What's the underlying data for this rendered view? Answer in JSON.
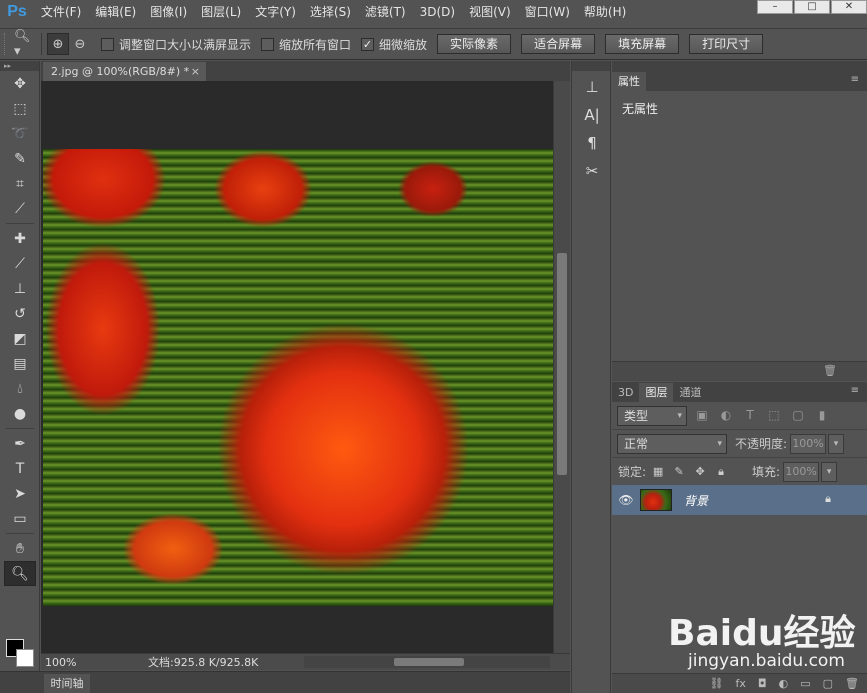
{
  "menubar": {
    "logo": "Ps",
    "items": [
      "文件(F)",
      "编辑(E)",
      "图像(I)",
      "图层(L)",
      "文字(Y)",
      "选择(S)",
      "滤镜(T)",
      "3D(D)",
      "视图(V)",
      "窗口(W)",
      "帮助(H)"
    ],
    "window_controls": [
      "–",
      "□",
      "✕"
    ]
  },
  "options": {
    "resize_windows": "调整窗口大小以满屏显示",
    "zoom_all": "缩放所有窗口",
    "scrubby_zoom": "细微缩放",
    "scrubby_checked": true,
    "btn_actual": "实际像素",
    "btn_fit": "适合屏幕",
    "btn_fill": "填充屏幕",
    "btn_print": "打印尺寸"
  },
  "document": {
    "tab_title": "2.jpg @ 100%(RGB/8#) *",
    "tab_close": "×",
    "zoom": "100%",
    "doc_size": "文档:925.8 K/925.8K"
  },
  "timeline": {
    "label": "时间轴"
  },
  "panels": {
    "properties_tab": "属性",
    "properties_text": "无属性",
    "tab_3d": "3D",
    "tab_layers": "图层",
    "tab_channels": "通道",
    "filter_kind": "类型",
    "blend_mode": "正常",
    "opacity_label": "不透明度:",
    "opacity_value": "100%",
    "lock_label": "锁定:",
    "fill_label": "填充:",
    "fill_value": "100%",
    "layer_name": "背景"
  },
  "watermark": {
    "brand": "Baidu经验",
    "url": "jingyan.baidu.com"
  },
  "colors": {
    "foreground": "#000000",
    "background": "#ffffff",
    "selected_layer": "#5a6f8a",
    "ps_logo": "#3f9ae0"
  }
}
